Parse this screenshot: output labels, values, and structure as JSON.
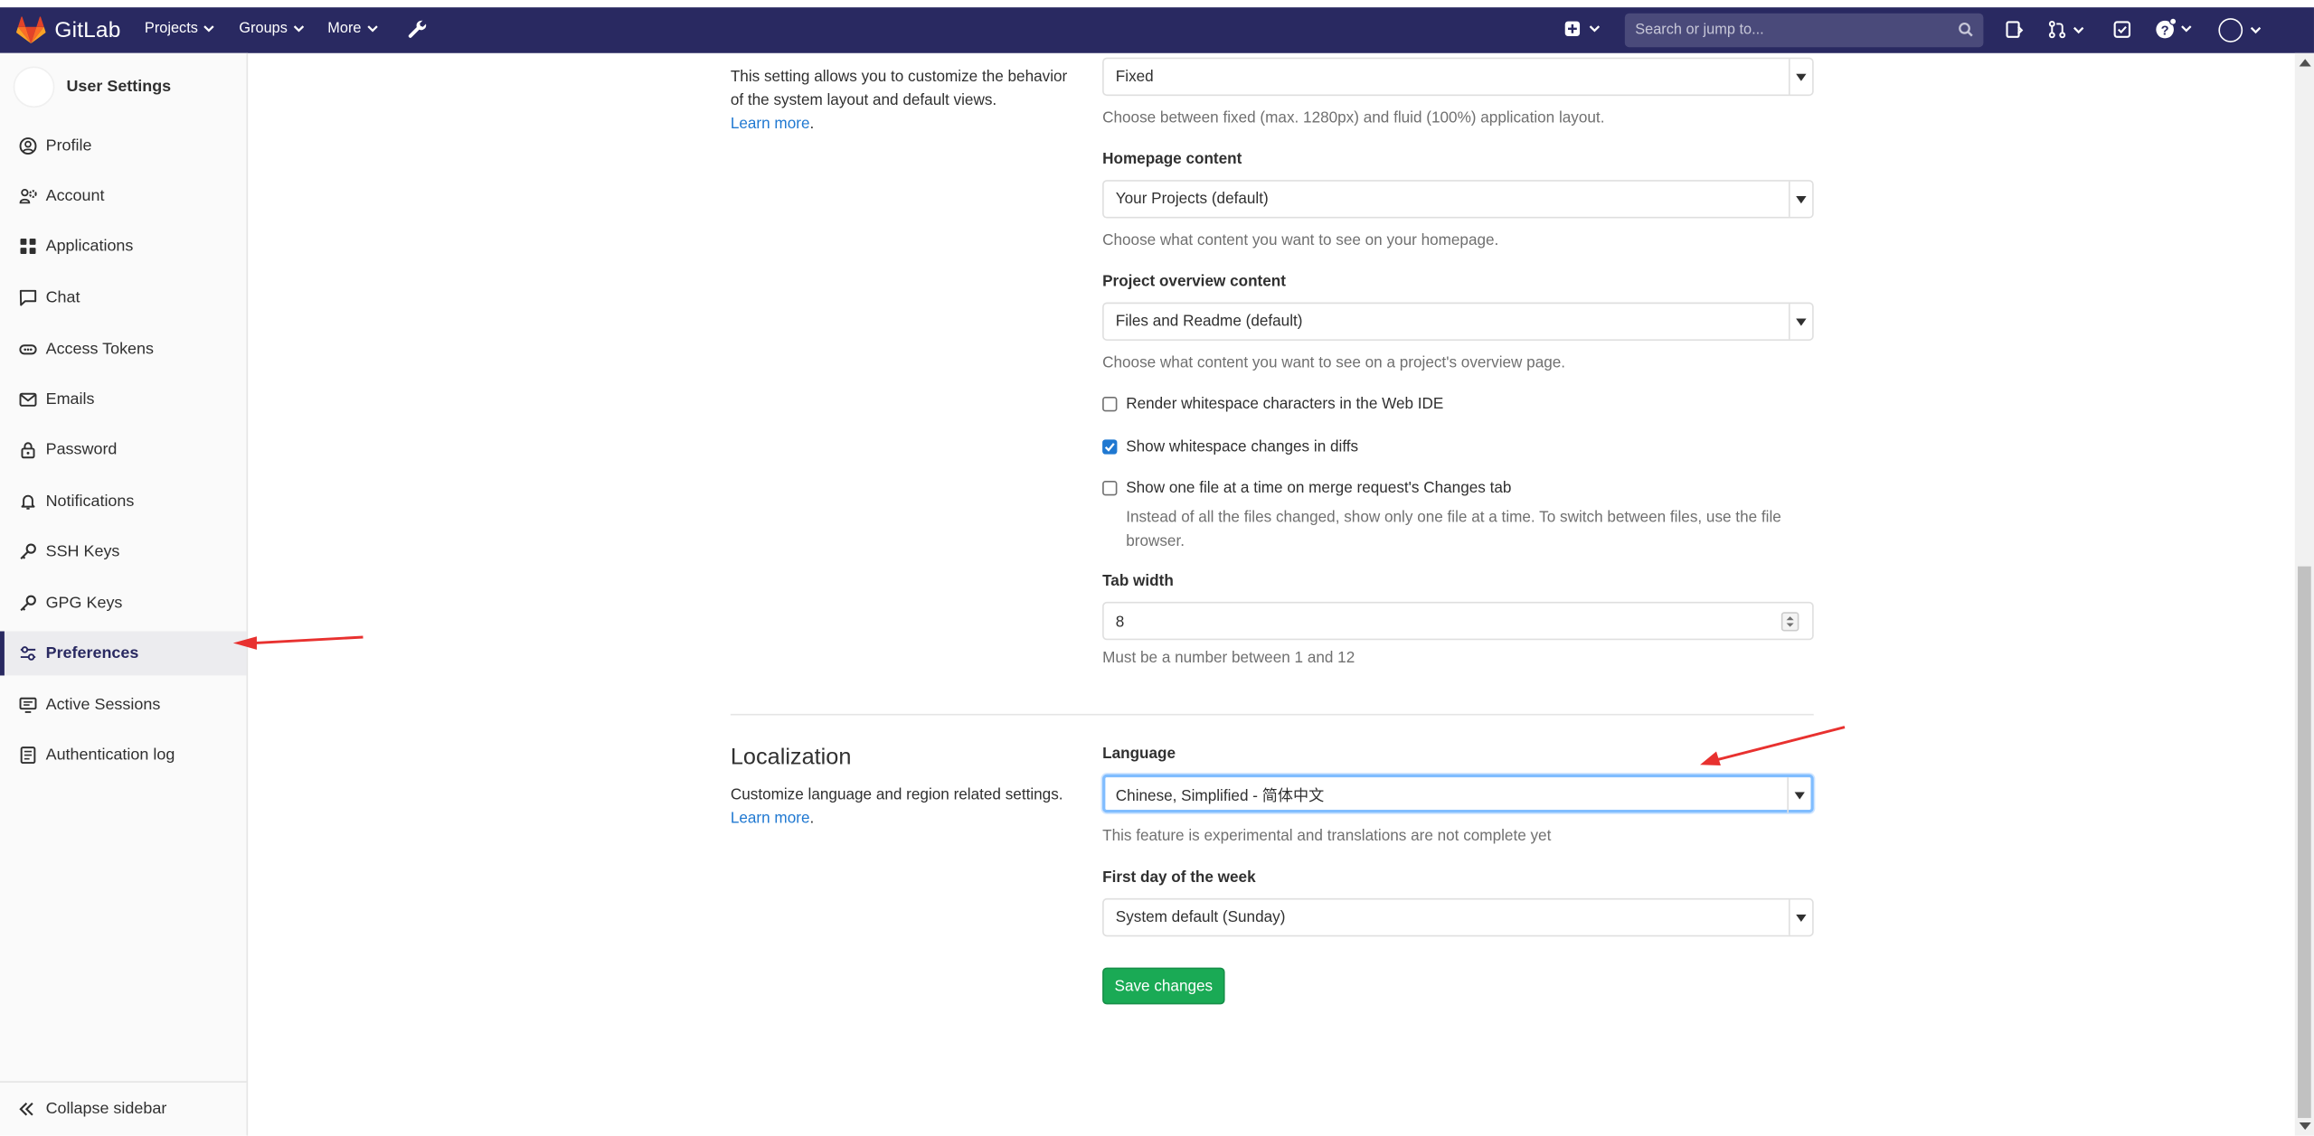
{
  "navbar": {
    "brand": "GitLab",
    "menus": [
      {
        "label": "Projects"
      },
      {
        "label": "Groups"
      },
      {
        "label": "More"
      }
    ],
    "search_placeholder": "Search or jump to..."
  },
  "sidebar": {
    "title": "User Settings",
    "items": [
      {
        "label": "Profile",
        "icon": "profile-icon"
      },
      {
        "label": "Account",
        "icon": "account-icon"
      },
      {
        "label": "Applications",
        "icon": "applications-icon"
      },
      {
        "label": "Chat",
        "icon": "chat-icon"
      },
      {
        "label": "Access Tokens",
        "icon": "token-icon"
      },
      {
        "label": "Emails",
        "icon": "mail-icon"
      },
      {
        "label": "Password",
        "icon": "lock-icon"
      },
      {
        "label": "Notifications",
        "icon": "bell-icon"
      },
      {
        "label": "SSH Keys",
        "icon": "key-icon"
      },
      {
        "label": "GPG Keys",
        "icon": "key-icon"
      },
      {
        "label": "Preferences",
        "icon": "preferences-icon",
        "active": true
      },
      {
        "label": "Active Sessions",
        "icon": "monitor-icon"
      },
      {
        "label": "Authentication log",
        "icon": "log-icon"
      }
    ],
    "collapse_label": "Collapse sidebar"
  },
  "behavior": {
    "description": "This setting allows you to customize the behavior of the system layout and default views.",
    "learn_more": "Learn more",
    "layout_value": "Fixed",
    "layout_help": "Choose between fixed (max. 1280px) and fluid (100%) application layout.",
    "homepage_label": "Homepage content",
    "homepage_value": "Your Projects (default)",
    "homepage_help": "Choose what content you want to see on your homepage.",
    "overview_label": "Project overview content",
    "overview_value": "Files and Readme (default)",
    "overview_help": "Choose what content you want to see on a project's overview page.",
    "checkboxes": [
      {
        "label": "Render whitespace characters in the Web IDE",
        "checked": false
      },
      {
        "label": "Show whitespace changes in diffs",
        "checked": true
      },
      {
        "label": "Show one file at a time on merge request's Changes tab",
        "checked": false
      }
    ],
    "one_file_help_line1": "Instead of all the files changed, show only one file at a time. To switch between files, use the file",
    "one_file_help_line2": "browser.",
    "tab_width_label": "Tab width",
    "tab_width_value": "8",
    "tab_width_help": "Must be a number between 1 and 12"
  },
  "localization": {
    "title": "Localization",
    "description": "Customize language and region related settings.",
    "learn_more": "Learn more",
    "language_label": "Language",
    "language_value": "Chinese, Simplified - 简体中文",
    "language_help": "This feature is experimental and translations are not complete yet",
    "first_day_label": "First day of the week",
    "first_day_value": "System default (Sunday)"
  },
  "save_button": "Save changes",
  "colors": {
    "navbar": "#292961",
    "save_button": "#1aaa55",
    "link": "#1f78d1",
    "annotation_arrow": "#e8312f"
  }
}
